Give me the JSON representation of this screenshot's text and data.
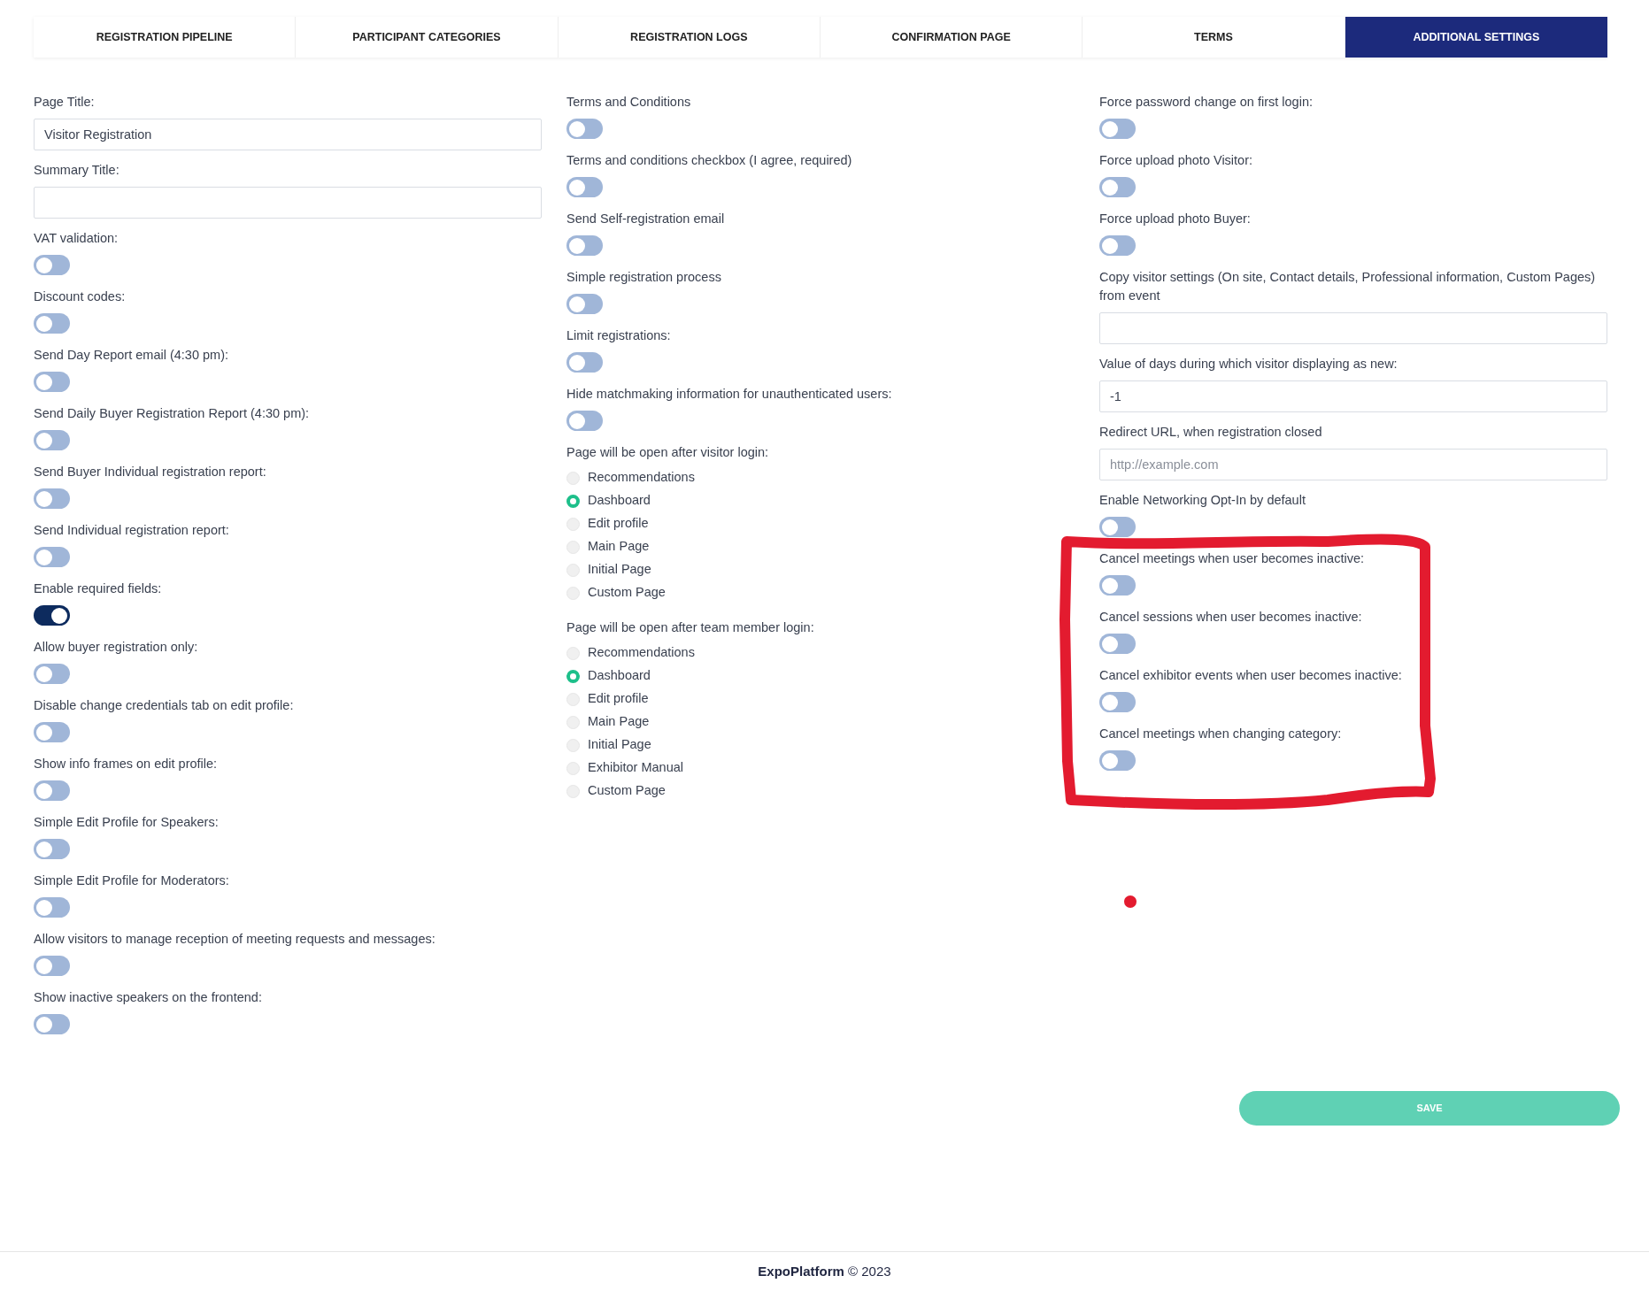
{
  "tabs": [
    {
      "label": "REGISTRATION PIPELINE",
      "selected": false
    },
    {
      "label": "PARTICIPANT CATEGORIES",
      "selected": false
    },
    {
      "label": "REGISTRATION LOGS",
      "selected": false
    },
    {
      "label": "CONFIRMATION PAGE",
      "selected": false
    },
    {
      "label": "TERMS",
      "selected": false
    },
    {
      "label": "ADDITIONAL SETTINGS",
      "selected": true
    }
  ],
  "columns": [
    {
      "items": [
        {
          "kind": "text_field",
          "label": "Page Title:",
          "value": "Visitor Registration"
        },
        {
          "kind": "text_field",
          "label": "Summary Title:"
        },
        {
          "kind": "toggle",
          "label": "VAT validation:",
          "on": false
        },
        {
          "kind": "toggle",
          "label": "Discount codes:",
          "on": false
        },
        {
          "kind": "toggle",
          "label": "Send Day Report email (4:30 pm):",
          "on": false
        },
        {
          "kind": "toggle",
          "label": "Send Daily Buyer Registration Report (4:30 pm):",
          "on": false
        },
        {
          "kind": "toggle",
          "label": "Send Buyer Individual registration report:",
          "on": false
        },
        {
          "kind": "toggle",
          "label": "Send Individual registration report:",
          "on": false
        },
        {
          "kind": "toggle",
          "label": "Enable required fields:",
          "on": true
        },
        {
          "kind": "toggle",
          "label": "Allow buyer registration only:",
          "on": false
        },
        {
          "kind": "toggle",
          "label": "Disable change credentials tab on edit profile:",
          "on": false
        },
        {
          "kind": "toggle",
          "label": "Show info frames on edit profile:",
          "on": false
        },
        {
          "kind": "toggle",
          "label": "Simple Edit Profile for Speakers:",
          "on": false
        },
        {
          "kind": "toggle",
          "label": "Simple Edit Profile for Moderators:",
          "on": false
        },
        {
          "kind": "toggle",
          "label": "Allow visitors to manage reception of meeting requests and messages:",
          "on": false
        },
        {
          "kind": "toggle",
          "label": "Show inactive speakers on the frontend:",
          "on": false
        }
      ]
    },
    {
      "items": [
        {
          "kind": "toggle",
          "label": "Terms and Conditions",
          "on": false
        },
        {
          "kind": "toggle",
          "label": "Terms and conditions checkbox (I agree, required)",
          "on": false
        },
        {
          "kind": "toggle",
          "label": "Send Self-registration email",
          "on": false
        },
        {
          "kind": "toggle",
          "label": "Simple registration process",
          "on": false
        },
        {
          "kind": "toggle",
          "label": "Limit registrations:",
          "on": false
        },
        {
          "kind": "toggle",
          "label": "Hide matchmaking information for unauthenticated users:",
          "on": false
        },
        {
          "kind": "radio_group",
          "label": "Page will be open after visitor login:",
          "options": [
            {
              "label": "Recommendations",
              "selected": false
            },
            {
              "label": "Dashboard",
              "selected": true
            },
            {
              "label": "Edit profile",
              "selected": false
            },
            {
              "label": "Main Page",
              "selected": false
            },
            {
              "label": "Initial Page",
              "selected": false
            },
            {
              "label": "Custom Page",
              "selected": false
            }
          ]
        },
        {
          "kind": "radio_group",
          "label": "Page will be open after team member login:",
          "options": [
            {
              "label": "Recommendations",
              "selected": false
            },
            {
              "label": "Dashboard",
              "selected": true
            },
            {
              "label": "Edit profile",
              "selected": false
            },
            {
              "label": "Main Page",
              "selected": false
            },
            {
              "label": "Initial Page",
              "selected": false
            },
            {
              "label": "Exhibitor Manual",
              "selected": false
            },
            {
              "label": "Custom Page",
              "selected": false
            }
          ]
        }
      ]
    },
    {
      "items": [
        {
          "kind": "toggle",
          "label": "Force password change on first login:",
          "on": false
        },
        {
          "kind": "toggle",
          "label": "Force upload photo Visitor:",
          "on": false
        },
        {
          "kind": "toggle",
          "label": "Force upload photo Buyer:",
          "on": false
        },
        {
          "kind": "text_field",
          "label": "Copy visitor settings (On site, Contact details, Professional information, Custom Pages) from event"
        },
        {
          "kind": "text_field",
          "label": "Value of days during which visitor displaying as new:",
          "value": "-1"
        },
        {
          "kind": "text_field",
          "label": "Redirect URL, when registration closed",
          "placeholder": "http://example.com"
        },
        {
          "kind": "toggle",
          "label": "Enable Networking Opt-In by default",
          "on": false
        },
        {
          "kind": "toggle",
          "label": "Cancel meetings when user becomes inactive:",
          "on": false
        },
        {
          "kind": "toggle",
          "label": "Cancel sessions when user becomes inactive:",
          "on": false
        },
        {
          "kind": "toggle",
          "label": "Cancel exhibitor events when user becomes inactive:",
          "on": false
        },
        {
          "kind": "toggle",
          "label": "Cancel meetings when changing category:",
          "on": false
        }
      ]
    }
  ],
  "save_button": "SAVE",
  "footer": {
    "brand": "ExpoPlatform",
    "copyright": "© 2023"
  }
}
